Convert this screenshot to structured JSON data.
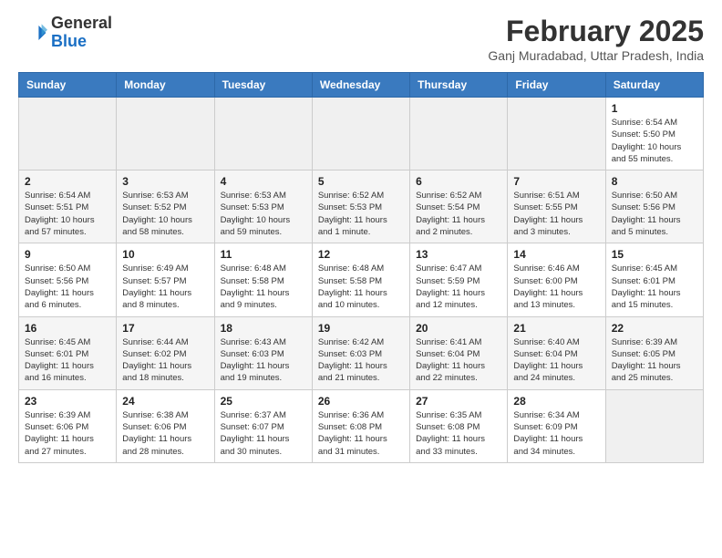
{
  "header": {
    "logo_general": "General",
    "logo_blue": "Blue",
    "month_title": "February 2025",
    "location": "Ganj Muradabad, Uttar Pradesh, India"
  },
  "weekdays": [
    "Sunday",
    "Monday",
    "Tuesday",
    "Wednesday",
    "Thursday",
    "Friday",
    "Saturday"
  ],
  "weeks": [
    [
      {
        "day": "",
        "info": ""
      },
      {
        "day": "",
        "info": ""
      },
      {
        "day": "",
        "info": ""
      },
      {
        "day": "",
        "info": ""
      },
      {
        "day": "",
        "info": ""
      },
      {
        "day": "",
        "info": ""
      },
      {
        "day": "1",
        "info": "Sunrise: 6:54 AM\nSunset: 5:50 PM\nDaylight: 10 hours and 55 minutes."
      }
    ],
    [
      {
        "day": "2",
        "info": "Sunrise: 6:54 AM\nSunset: 5:51 PM\nDaylight: 10 hours and 57 minutes."
      },
      {
        "day": "3",
        "info": "Sunrise: 6:53 AM\nSunset: 5:52 PM\nDaylight: 10 hours and 58 minutes."
      },
      {
        "day": "4",
        "info": "Sunrise: 6:53 AM\nSunset: 5:53 PM\nDaylight: 10 hours and 59 minutes."
      },
      {
        "day": "5",
        "info": "Sunrise: 6:52 AM\nSunset: 5:53 PM\nDaylight: 11 hours and 1 minute."
      },
      {
        "day": "6",
        "info": "Sunrise: 6:52 AM\nSunset: 5:54 PM\nDaylight: 11 hours and 2 minutes."
      },
      {
        "day": "7",
        "info": "Sunrise: 6:51 AM\nSunset: 5:55 PM\nDaylight: 11 hours and 3 minutes."
      },
      {
        "day": "8",
        "info": "Sunrise: 6:50 AM\nSunset: 5:56 PM\nDaylight: 11 hours and 5 minutes."
      }
    ],
    [
      {
        "day": "9",
        "info": "Sunrise: 6:50 AM\nSunset: 5:56 PM\nDaylight: 11 hours and 6 minutes."
      },
      {
        "day": "10",
        "info": "Sunrise: 6:49 AM\nSunset: 5:57 PM\nDaylight: 11 hours and 8 minutes."
      },
      {
        "day": "11",
        "info": "Sunrise: 6:48 AM\nSunset: 5:58 PM\nDaylight: 11 hours and 9 minutes."
      },
      {
        "day": "12",
        "info": "Sunrise: 6:48 AM\nSunset: 5:58 PM\nDaylight: 11 hours and 10 minutes."
      },
      {
        "day": "13",
        "info": "Sunrise: 6:47 AM\nSunset: 5:59 PM\nDaylight: 11 hours and 12 minutes."
      },
      {
        "day": "14",
        "info": "Sunrise: 6:46 AM\nSunset: 6:00 PM\nDaylight: 11 hours and 13 minutes."
      },
      {
        "day": "15",
        "info": "Sunrise: 6:45 AM\nSunset: 6:01 PM\nDaylight: 11 hours and 15 minutes."
      }
    ],
    [
      {
        "day": "16",
        "info": "Sunrise: 6:45 AM\nSunset: 6:01 PM\nDaylight: 11 hours and 16 minutes."
      },
      {
        "day": "17",
        "info": "Sunrise: 6:44 AM\nSunset: 6:02 PM\nDaylight: 11 hours and 18 minutes."
      },
      {
        "day": "18",
        "info": "Sunrise: 6:43 AM\nSunset: 6:03 PM\nDaylight: 11 hours and 19 minutes."
      },
      {
        "day": "19",
        "info": "Sunrise: 6:42 AM\nSunset: 6:03 PM\nDaylight: 11 hours and 21 minutes."
      },
      {
        "day": "20",
        "info": "Sunrise: 6:41 AM\nSunset: 6:04 PM\nDaylight: 11 hours and 22 minutes."
      },
      {
        "day": "21",
        "info": "Sunrise: 6:40 AM\nSunset: 6:04 PM\nDaylight: 11 hours and 24 minutes."
      },
      {
        "day": "22",
        "info": "Sunrise: 6:39 AM\nSunset: 6:05 PM\nDaylight: 11 hours and 25 minutes."
      }
    ],
    [
      {
        "day": "23",
        "info": "Sunrise: 6:39 AM\nSunset: 6:06 PM\nDaylight: 11 hours and 27 minutes."
      },
      {
        "day": "24",
        "info": "Sunrise: 6:38 AM\nSunset: 6:06 PM\nDaylight: 11 hours and 28 minutes."
      },
      {
        "day": "25",
        "info": "Sunrise: 6:37 AM\nSunset: 6:07 PM\nDaylight: 11 hours and 30 minutes."
      },
      {
        "day": "26",
        "info": "Sunrise: 6:36 AM\nSunset: 6:08 PM\nDaylight: 11 hours and 31 minutes."
      },
      {
        "day": "27",
        "info": "Sunrise: 6:35 AM\nSunset: 6:08 PM\nDaylight: 11 hours and 33 minutes."
      },
      {
        "day": "28",
        "info": "Sunrise: 6:34 AM\nSunset: 6:09 PM\nDaylight: 11 hours and 34 minutes."
      },
      {
        "day": "",
        "info": ""
      }
    ]
  ]
}
